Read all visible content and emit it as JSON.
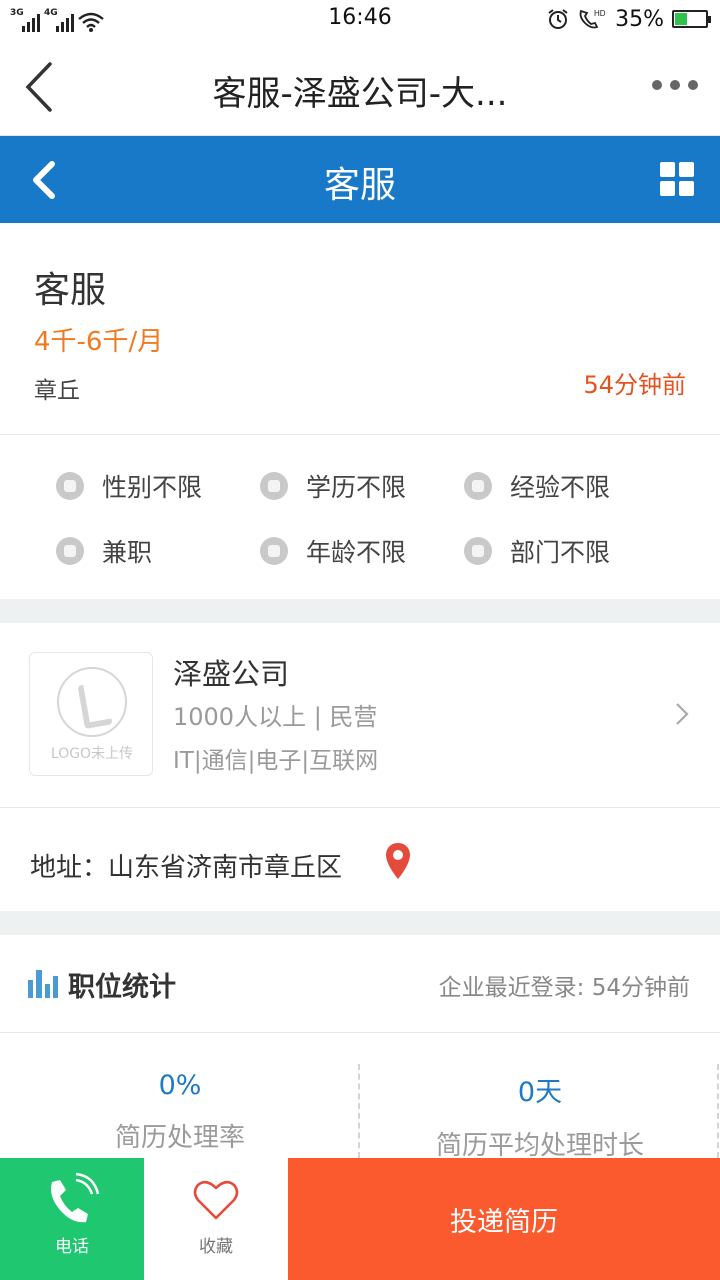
{
  "status_bar": {
    "network_1": "3G",
    "network_2": "4G",
    "time": "16:46",
    "battery_percent": "35%",
    "battery_level": 0.35,
    "icons": [
      "signal-icon",
      "wifi-icon",
      "alarm-icon",
      "hd-call-icon",
      "battery-icon"
    ]
  },
  "header": {
    "title": "客服-泽盛公司-大...",
    "back_icon": "back-chevron-icon",
    "more_icon": "more-dots-icon"
  },
  "blue_bar": {
    "title": "客服",
    "back_icon": "back-icon",
    "grid_icon": "grid-icon",
    "color": "#1779c7"
  },
  "job": {
    "title": "客服",
    "salary": "4千-6千/月",
    "location": "章丘",
    "posted": "54分钟前",
    "salary_color": "#f07a1f",
    "posted_color": "#e4521f"
  },
  "requirements": [
    {
      "label": "性别不限",
      "icon": "gender-icon"
    },
    {
      "label": "学历不限",
      "icon": "education-icon"
    },
    {
      "label": "经验不限",
      "icon": "experience-icon"
    },
    {
      "label": "兼职",
      "icon": "job-type-icon"
    },
    {
      "label": "年龄不限",
      "icon": "age-icon"
    },
    {
      "label": "部门不限",
      "icon": "department-icon"
    }
  ],
  "company": {
    "logo_text": "LOGO未上传",
    "name": "泽盛公司",
    "size_type": "1000人以上 | 民营",
    "industry": "IT|通信|电子|互联网"
  },
  "address": {
    "text": "地址：山东省济南市章丘区",
    "icon": "location-pin-icon",
    "pin_color": "#e54b3c"
  },
  "stats": {
    "title": "职位统计",
    "last_login": "企业最近登录: 54分钟前",
    "metrics": [
      {
        "value": "0%",
        "label": "简历处理率"
      },
      {
        "value": "0天",
        "label": "简历平均处理时长"
      }
    ]
  },
  "bottom_bar": {
    "phone_label": "电话",
    "favorite_label": "收藏",
    "submit_label": "投递简历",
    "phone_color": "#1fc870",
    "submit_color": "#fa5a2e"
  }
}
